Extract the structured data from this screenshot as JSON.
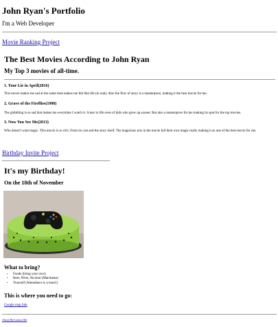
{
  "site": {
    "title": "John Ryan's Portfolio",
    "subtitle": "I'm a Web Developer"
  },
  "movies": {
    "link": "Movie Ranking Project",
    "heading": "The Best Movies According to John Ryan",
    "subheading": "My Top 3 movies of all-time.",
    "items": [
      {
        "title": "1. Your Lie in April(2016)",
        "description": "This movie makes me sad at the same time makes me felt like life (in real). Also the flow of story is a masterpiece, making it the best movie for me."
      },
      {
        "title": "2. Grave of the Fireflies(1988)",
        "description": "The globbling is so sad that makes me everytime I watch it. A tear to life even of kids who grew up sooner. But also a masterpiece for me making its spot for the top movies."
      },
      {
        "title": "3. Now You See Me(2013)",
        "description": "Who doesn't want magic. This movie is so rich. From its cast and the story itself. The magicians acts in the movie kill their own magic really making it as one of the best movie for me."
      }
    ]
  },
  "birthday": {
    "link": "Birthday Invite Project",
    "heading": "It's my Birthday!",
    "date": "On the 18th of November",
    "bring_heading": "What to bring?",
    "bring_items": [
      "Foods (bring your own)",
      "Beer, Wine, Alcohol (Matchatea)",
      "Yourself (Attendance is a must!)"
    ],
    "where_heading": "This is where you need to go:",
    "maps_link": "Google map link"
  },
  "footer": {
    "link": "About Me/Contact Me"
  }
}
